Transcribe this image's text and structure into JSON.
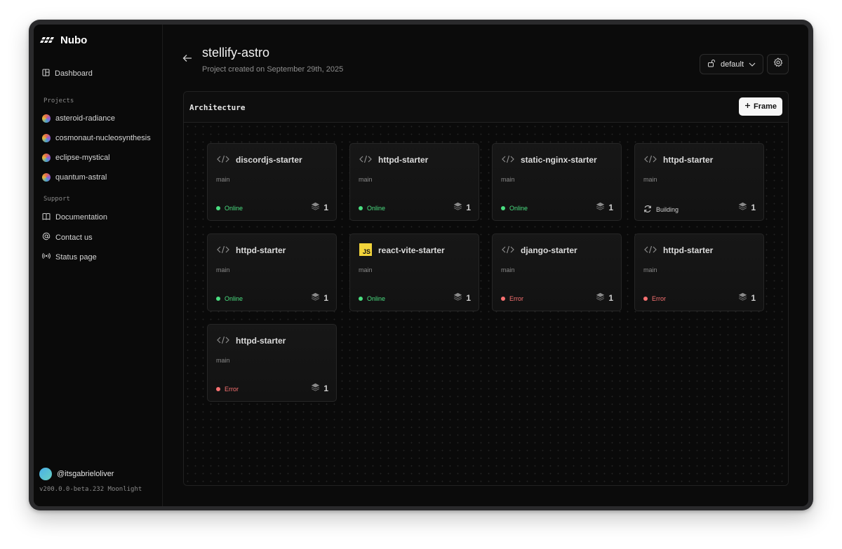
{
  "app": {
    "name": "Nubo"
  },
  "sidebar": {
    "dashboard_label": "Dashboard",
    "projects_heading": "Projects",
    "projects": [
      {
        "label": "asteroid-radiance"
      },
      {
        "label": "cosmonaut-nucleosynthesis"
      },
      {
        "label": "eclipse-mystical"
      },
      {
        "label": "quantum-astral"
      }
    ],
    "support_heading": "Support",
    "support": [
      {
        "label": "Documentation",
        "icon": "book-icon"
      },
      {
        "label": "Contact us",
        "icon": "at-sign-icon"
      },
      {
        "label": "Status page",
        "icon": "broadcast-icon"
      }
    ],
    "user": "@itsgabrieloliver",
    "version": "v200.0.0-beta.232 Moonlight"
  },
  "header": {
    "title": "stellify-astro",
    "subtitle": "Project created on September 29th, 2025",
    "environment": "default"
  },
  "panel": {
    "title": "Architecture",
    "frame_button": "Frame"
  },
  "status_colors": {
    "online": "#4ade80",
    "error": "#f87171",
    "building": "#cfcfcf"
  },
  "services": [
    {
      "name": "discordjs-starter",
      "branch": "main",
      "status": "Online",
      "kind": "online",
      "count": "1",
      "icon": "code-icon"
    },
    {
      "name": "httpd-starter",
      "branch": "main",
      "status": "Online",
      "kind": "online",
      "count": "1",
      "icon": "code-icon"
    },
    {
      "name": "static-nginx-starter",
      "branch": "main",
      "status": "Online",
      "kind": "online",
      "count": "1",
      "icon": "code-icon"
    },
    {
      "name": "httpd-starter",
      "branch": "main",
      "status": "Building",
      "kind": "building",
      "count": "1",
      "icon": "code-icon"
    },
    {
      "name": "httpd-starter",
      "branch": "main",
      "status": "Online",
      "kind": "online",
      "count": "1",
      "icon": "code-icon"
    },
    {
      "name": "react-vite-starter",
      "branch": "main",
      "status": "Online",
      "kind": "online",
      "count": "1",
      "icon": "js-icon",
      "icon_text": "JS"
    },
    {
      "name": "django-starter",
      "branch": "main",
      "status": "Error",
      "kind": "error",
      "count": "1",
      "icon": "code-icon"
    },
    {
      "name": "httpd-starter",
      "branch": "main",
      "status": "Error",
      "kind": "error",
      "count": "1",
      "icon": "code-icon"
    },
    {
      "name": "httpd-starter",
      "branch": "main",
      "status": "Error",
      "kind": "error",
      "count": "1",
      "icon": "code-icon"
    }
  ]
}
